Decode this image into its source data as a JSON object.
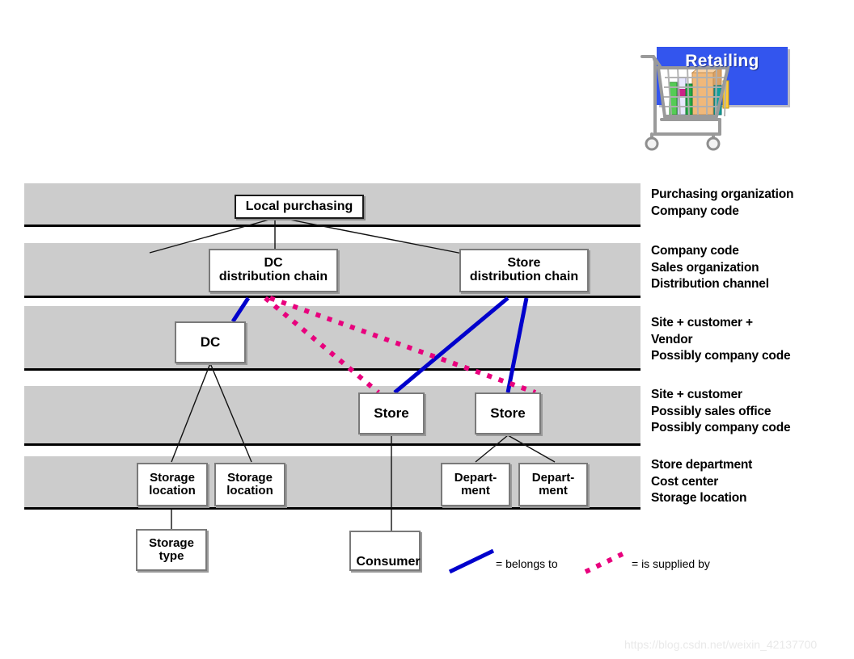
{
  "banner": {
    "title": "Retailing",
    "bg_color": "#3355ee",
    "text_color": "#ffffff",
    "cart_icon": "shopping-cart-icon"
  },
  "levels": [
    {
      "id": "level-1",
      "lines": [
        "Purchasing organization",
        "Company code"
      ]
    },
    {
      "id": "level-2",
      "lines": [
        "Company code",
        "Sales organization",
        "Distribution channel"
      ]
    },
    {
      "id": "level-3",
      "lines": [
        "Site + customer +",
        "Vendor",
        "Possibly company code"
      ]
    },
    {
      "id": "level-4",
      "lines": [
        "Site + customer",
        "Possibly sales office",
        "Possibly company code"
      ]
    },
    {
      "id": "level-5",
      "lines": [
        "Store department",
        "Cost center",
        "Storage location"
      ]
    }
  ],
  "nodes": {
    "local_purchasing": {
      "label": "Local purchasing"
    },
    "dc_distribution_chain": {
      "line1": "DC",
      "line2": "distribution chain"
    },
    "store_distribution_chain": {
      "line1": "Store",
      "line2": "distribution chain"
    },
    "dc": {
      "label": "DC"
    },
    "store_left": {
      "label": "Store"
    },
    "store_right": {
      "label": "Store"
    },
    "storage_location_1": {
      "line1": "Storage",
      "line2": "location"
    },
    "storage_location_2": {
      "line1": "Storage",
      "line2": "location"
    },
    "department_1": {
      "line1": "Depart-",
      "line2": "ment"
    },
    "department_2": {
      "line1": "Depart-",
      "line2": "ment"
    },
    "storage_type": {
      "line1": "Storage",
      "line2": "type"
    },
    "consumer": {
      "label": "Consumer"
    }
  },
  "legend": {
    "belongs_to": {
      "label": "= belongs to",
      "color": "#0000cc",
      "style": "solid"
    },
    "is_supplied_by": {
      "label": "= is supplied by",
      "color": "#e8007d",
      "style": "dotted"
    }
  },
  "colors": {
    "band": "#cccccc",
    "band_border": "#000000",
    "node_bg": "#ffffff",
    "node_border": "#1a1a1a",
    "blue_link": "#0000cc",
    "pink_link": "#e8007d",
    "thin_link": "#111111"
  },
  "watermark": {
    "text": "https://blog.csdn.net/weixin_42137700"
  }
}
